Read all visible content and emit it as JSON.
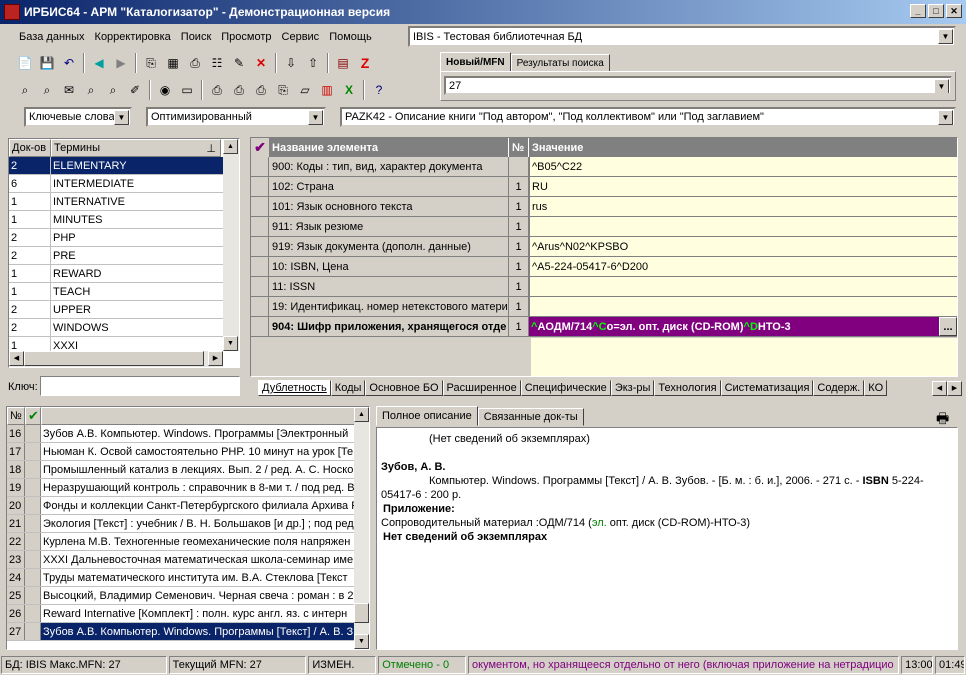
{
  "window": {
    "title": "ИРБИС64 - АРМ \"Каталогизатор\" - Демонстрационная версия"
  },
  "menu": [
    "База данных",
    "Корректировка",
    "Поиск",
    "Просмотр",
    "Сервис",
    "Помощь"
  ],
  "database_combo": "IBIS - Тестовая библиотечная БД",
  "mfn_tabs": [
    "Новый/MFN",
    "Результаты поиска"
  ],
  "mfn_value": "27",
  "search_mode": "Ключевые слова",
  "optimization": "Оптимизированный",
  "worksheet": "PAZK42 - Описание книги \"Под автором\", \"Под коллективом\" или \"Под заглавием\"",
  "dictionary": {
    "headers": [
      "Док-ов",
      "Термины"
    ],
    "rows": [
      {
        "count": "2",
        "term": "ELEMENTARY"
      },
      {
        "count": "6",
        "term": "INTERMEDIATE"
      },
      {
        "count": "1",
        "term": "INTERNATIVE"
      },
      {
        "count": "1",
        "term": "MINUTES"
      },
      {
        "count": "2",
        "term": "PHP"
      },
      {
        "count": "2",
        "term": "PRE"
      },
      {
        "count": "1",
        "term": "REWARD"
      },
      {
        "count": "1",
        "term": "TEACH"
      },
      {
        "count": "2",
        "term": "UPPER"
      },
      {
        "count": "2",
        "term": "WINDOWS"
      },
      {
        "count": "1",
        "term": "XXXI"
      }
    ],
    "key_label": "Ключ:"
  },
  "fields": {
    "headers": [
      "Название элемента",
      "№",
      "Значение"
    ],
    "rows": [
      {
        "name": "900: Коды : тип, вид, характер документа",
        "num": "",
        "value": "^B05^C22"
      },
      {
        "name": "102: Страна",
        "num": "1",
        "value": "RU"
      },
      {
        "name": "101: Язык основного текста",
        "num": "1",
        "value": "rus"
      },
      {
        "name": "911: Язык резюме",
        "num": "1",
        "value": ""
      },
      {
        "name": "919: Язык документа (дополн. данные)",
        "num": "1",
        "value": "^Arus^N02^KPSBO"
      },
      {
        "name": "10: ISBN, Цена",
        "num": "1",
        "value": "^A5-224-05417-6^D200"
      },
      {
        "name": "11: ISSN",
        "num": "1",
        "value": ""
      },
      {
        "name": "19: Идентификац. номер нетекстового матери",
        "num": "1",
        "value": ""
      },
      {
        "name": "904: Шифр приложения, хранящегося отде",
        "num": "1",
        "value": "^AОДМ/714^Co=эл. опт. диск (CD-ROM)^DНТО-3"
      }
    ],
    "selected_parts": [
      {
        "t": "^",
        "c": "#00ff00"
      },
      {
        "t": "AОДМ/714",
        "c": "#ffffff"
      },
      {
        "t": "^",
        "c": "#00ff00"
      },
      {
        "t": "C",
        "c": "#00ff00"
      },
      {
        "t": "o=эл. опт. диск (CD-ROM)",
        "c": "#ffffff"
      },
      {
        "t": "^",
        "c": "#00ff00"
      },
      {
        "t": "D",
        "c": "#00ff00"
      },
      {
        "t": "НТО-3",
        "c": "#ffffff"
      }
    ],
    "ellipsis": "..."
  },
  "worksheet_tabs": [
    "Дублетность",
    "Коды",
    "Основное БО",
    "Расширенное",
    "Специфические",
    "Экз-ры",
    "Технология",
    "Систематизация",
    "Содерж.",
    "КО"
  ],
  "records": {
    "header_num": "№",
    "rows": [
      {
        "n": "16",
        "text": "Зубов А.В. Компьютер. Windows. Программы [Электронный"
      },
      {
        "n": "17",
        "text": "Ньюман К. Освой самостоятельно PHP. 10 минут на урок [Те"
      },
      {
        "n": "18",
        "text": "Промышленный катализ в лекциях. Вып. 2 / ред. А. С. Носко"
      },
      {
        "n": "19",
        "text": "Неразрушающий контроль : справочник в 8-ми т. / под ред. В"
      },
      {
        "n": "20",
        "text": "Фонды и коллекции Санкт-Петербургского филиала Архива Р"
      },
      {
        "n": "21",
        "text": "Экология [Текст] : учебник / В. Н. Большаков [и др.] ; под ред"
      },
      {
        "n": "22",
        "text": "Курлена М.В. Техногенные геомеханические поля напряжен"
      },
      {
        "n": "23",
        "text": "XXXI Дальневосточная математическая школа-семинар име"
      },
      {
        "n": "24",
        "text": "Труды математического института им. В.А. Стеклова [Текст"
      },
      {
        "n": "25",
        "text": "Высоцкий, Владимир Семенович. Черная свеча : роман : в 2"
      },
      {
        "n": "26",
        "text": "Reward Internative [Комплект] : полн. курс англ. яз. с интерн"
      },
      {
        "n": "27",
        "text": "Зубов А.В. Компьютер. Windows. Программы [Текст] / А. В. З"
      }
    ]
  },
  "description_tabs": [
    "Полное описание",
    "Связанные док-ты"
  ],
  "description": {
    "no_copies_top": "(Нет сведений об экземплярах)",
    "author": "Зубов, А. В.",
    "body_pre": "Компьютер. Windows. Программы [Текст] / А. В. Зубов. - [Б. м. : б. и.], 2006. - 271 с. - ",
    "isbn_label": "ISBN",
    "body_post": " 5-224-05417-6 : 200 р.",
    "appendix_label": "Приложение:",
    "appendix_pre": "Сопроводительный материал :ОДМ/714 (",
    "appendix_green": "эл.",
    "appendix_post": " опт. диск (CD-ROM)-НТО-3)",
    "no_copies_bold": "Нет сведений об экземплярах"
  },
  "status": {
    "db": "БД: IBIS Макс.MFN: 27",
    "current": "Текущий MFN: 27",
    "changed": "ИЗМЕН.",
    "marked": "Отмечено - 0",
    "hint": "окументом, но хранящееся отдельно от него (включая приложение на нетрадицио",
    "time1": "13:00",
    "time2": "01:49"
  },
  "colors": {
    "selected_row": "#0a246a",
    "field_selected": "#800080",
    "value_bg": "#ffffe0",
    "marked_text": "#008000",
    "hint_text": "#800080"
  }
}
